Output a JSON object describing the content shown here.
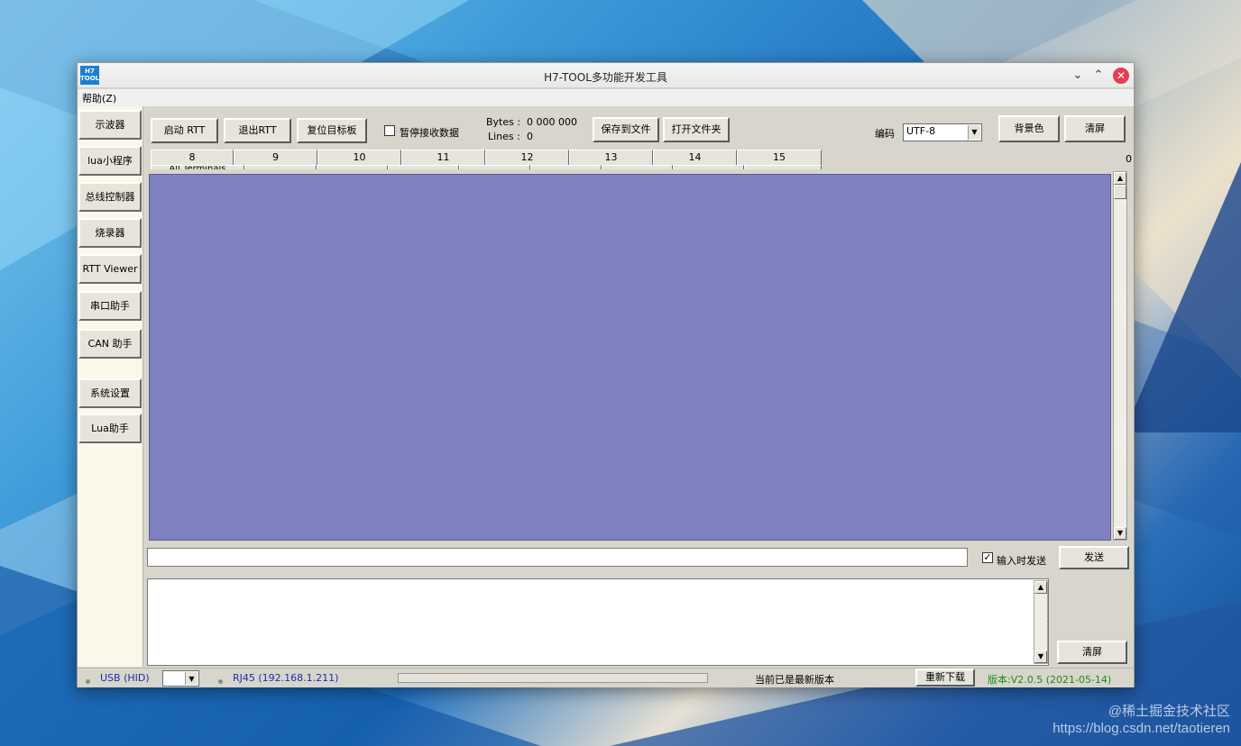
{
  "window": {
    "title": "H7-TOOL多功能开发工具",
    "icon_text_line1": "H7",
    "icon_text_line2": "TOOL"
  },
  "menubar": {
    "help": "帮助(Z)"
  },
  "sidebar": {
    "items": [
      {
        "label": "示波器"
      },
      {
        "label": "lua小程序"
      },
      {
        "label": "总线控制器"
      },
      {
        "label": "烧录器"
      },
      {
        "label": "RTT Viewer"
      },
      {
        "label": "串口助手"
      },
      {
        "label": "CAN 助手"
      },
      {
        "label": "系统设置"
      },
      {
        "label": "Lua助手"
      }
    ]
  },
  "toolbar": {
    "start_rtt": "启动 RTT",
    "exit_rtt": "退出RTT",
    "reset_target": "复位目标板",
    "pause_label": "暂停接收数据",
    "pause_checked": false,
    "bytes_label": "Bytes :",
    "bytes_value": "0 000 000",
    "lines_label": "Lines :",
    "lines_value": "0",
    "save_to_file": "保存到文件",
    "open_folder": "打开文件夹",
    "encoding_label": "编码",
    "encoding_value": "UTF-8",
    "bg_color": "背景色",
    "clear": "清屏",
    "counter": "0"
  },
  "tabs": {
    "row1": [
      "8",
      "9",
      "10",
      "11",
      "12",
      "13",
      "14",
      "15"
    ],
    "row2_first": "All Terminals"
  },
  "terminal": {
    "bg_color": "#7f80bf"
  },
  "send": {
    "input_value": "",
    "send_on_input_label": "输入时发送",
    "send_on_input_checked": true,
    "send_button": "发送"
  },
  "log": {
    "clear_button": "清屏"
  },
  "status": {
    "usb": "USB (HID)",
    "rj45": "RJ45 (192.168.1.211)",
    "update_status": "当前已是最新版本",
    "redownload": "重新下载",
    "version": "版本:V2.0.5 (2021-05-14)"
  },
  "watermark": {
    "line1": "@稀土掘金技术社区",
    "line2": "https://blog.csdn.net/taotieren"
  }
}
